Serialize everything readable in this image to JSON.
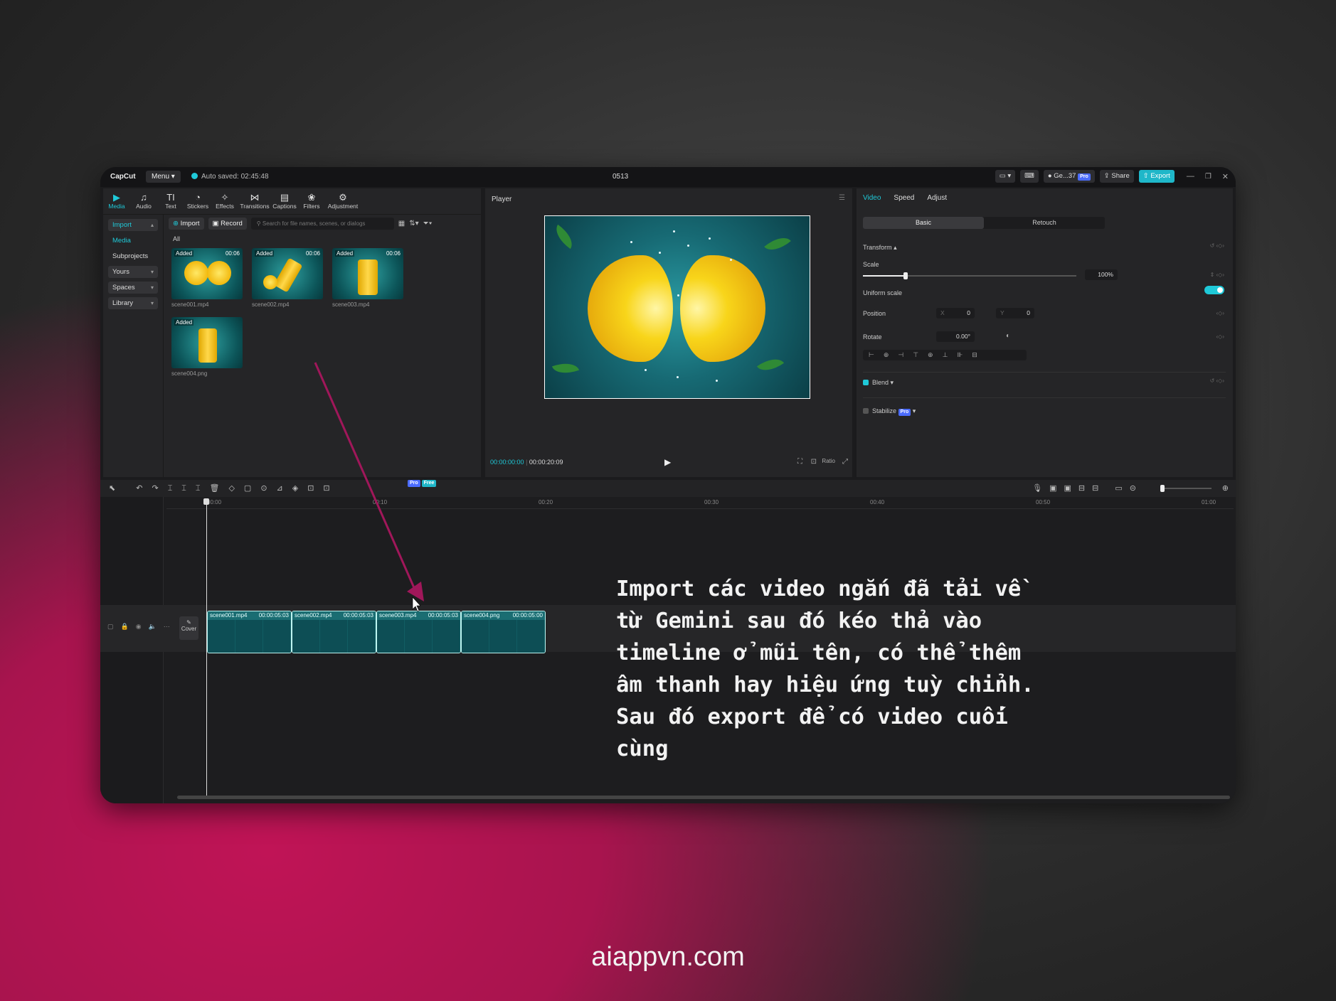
{
  "titlebar": {
    "app_logo": "CapCut",
    "menu_label": "Menu",
    "autosave_text": "Auto saved: 02:45:48",
    "project_name": "0513",
    "account_label": "Ge...37",
    "share_label": "Share",
    "export_label": "Export"
  },
  "media_tabs": [
    {
      "label": "Media",
      "icon": "▶"
    },
    {
      "label": "Audio",
      "icon": "♫"
    },
    {
      "label": "Text",
      "icon": "TI"
    },
    {
      "label": "Stickers",
      "icon": "◔"
    },
    {
      "label": "Effects",
      "icon": "✧"
    },
    {
      "label": "Transitions",
      "icon": "⋈"
    },
    {
      "label": "Captions",
      "icon": "▤"
    },
    {
      "label": "Filters",
      "icon": "❀"
    },
    {
      "label": "Adjustment",
      "icon": "⚙"
    }
  ],
  "sidebar": {
    "import": "Import",
    "media": "Media",
    "subprojects": "Subprojects",
    "yours": "Yours",
    "spaces": "Spaces",
    "library": "Library"
  },
  "media_bar": {
    "import_btn": "Import",
    "record_btn": "Record",
    "search_placeholder": "Search for file names, scenes, or dialogs",
    "filter_all": "All"
  },
  "media_items": [
    {
      "name": "scene001.mp4",
      "tag": "Added",
      "duration": "00:06"
    },
    {
      "name": "scene002.mp4",
      "tag": "Added",
      "duration": "00:06"
    },
    {
      "name": "scene003.mp4",
      "tag": "Added",
      "duration": "00:06"
    },
    {
      "name": "scene004.png",
      "tag": "Added",
      "duration": ""
    }
  ],
  "player": {
    "title": "Player",
    "current_time": "00:00:00:00",
    "total_time": "00:00:20:09",
    "ratio_label": "Ratio"
  },
  "properties": {
    "tabs": [
      "Video",
      "Speed",
      "Adjust"
    ],
    "segment": [
      "Basic",
      "Retouch"
    ],
    "transform_label": "Transform",
    "scale_label": "Scale",
    "scale_value": "100%",
    "scale_fraction": 0.2,
    "uniform_scale_label": "Uniform scale",
    "position_label": "Position",
    "pos_x_label": "X",
    "pos_x": "0",
    "pos_y_label": "Y",
    "pos_y": "0",
    "rotate_label": "Rotate",
    "rotate_value": "0.00°",
    "blend_label": "Blend",
    "stabilize_label": "Stabilize",
    "pro_badge": "Pro"
  },
  "timeline": {
    "badge_pro": "Pro",
    "badge_free": "Free",
    "ruler": [
      "00:00",
      "00:10",
      "00:20",
      "00:30",
      "00:40",
      "00:50",
      "01:00"
    ],
    "cover_label": "Cover",
    "clips": [
      {
        "name": "scene001.mp4",
        "duration": "00:00:05:03"
      },
      {
        "name": "scene002.mp4",
        "duration": "00:00:05:03"
      },
      {
        "name": "scene003.mp4",
        "duration": "00:00:05:03"
      },
      {
        "name": "scene004.png",
        "duration": "00:00:05:00"
      }
    ]
  },
  "overlay_caption": "Import các video ngắn đã tải về\ntừ Gemini sau đó kéo thả vào\ntimeline ở mũi tên, có thể thêm\nâm thanh hay hiệu ứng tuỳ chỉnh.\nSau đó export để có video cuối\ncùng",
  "footer": "aiappvn.com",
  "colors": {
    "accent": "#1fc9d8",
    "arrow": "#a0175a",
    "background_glow": "#c01456"
  }
}
